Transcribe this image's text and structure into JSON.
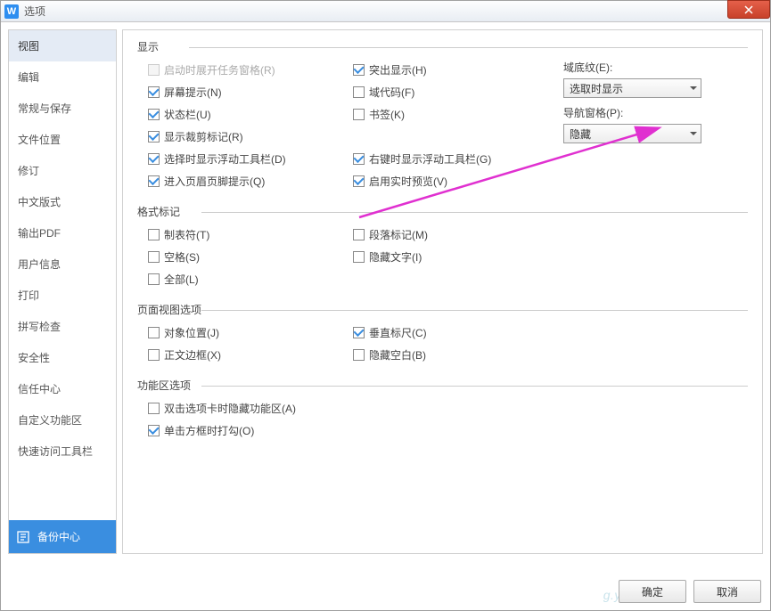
{
  "window": {
    "title": "选项",
    "logo_text": "W"
  },
  "sidebar": {
    "items": [
      "视图",
      "编辑",
      "常规与保存",
      "文件位置",
      "修订",
      "中文版式",
      "输出PDF",
      "用户信息",
      "打印",
      "拼写检查",
      "安全性",
      "信任中心",
      "自定义功能区",
      "快速访问工具栏"
    ],
    "active_index": 0,
    "backup_center": "备份中心"
  },
  "sections": {
    "display": {
      "title": "显示",
      "opts": {
        "startup_taskpane": "启动时展开任务窗格(R)",
        "screen_tip": "屏幕提示(N)",
        "status_bar": "状态栏(U)",
        "crop_marks": "显示裁剪标记(R)",
        "float_toolbar_select": "选择时显示浮动工具栏(D)",
        "header_footer_hint": "进入页眉页脚提示(Q)",
        "highlight": "突出显示(H)",
        "field_codes": "域代码(F)",
        "bookmarks": "书签(K)",
        "float_toolbar_rclick": "右键时显示浮动工具栏(G)",
        "live_preview": "启用实时预览(V)"
      },
      "field_shading_label": "域底纹(E):",
      "field_shading_value": "选取时显示",
      "nav_pane_label": "导航窗格(P):",
      "nav_pane_value": "隐藏"
    },
    "format_marks": {
      "title": "格式标记",
      "opts": {
        "tabs": "制表符(T)",
        "spaces": "空格(S)",
        "all": "全部(L)",
        "para_marks": "段落标记(M)",
        "hidden_text": "隐藏文字(I)"
      }
    },
    "page_view": {
      "title": "页面视图选项",
      "opts": {
        "object_pos": "对象位置(J)",
        "text_bounds": "正文边框(X)",
        "vertical_ruler": "垂直标尺(C)",
        "hide_blank": "隐藏空白(B)"
      }
    },
    "ribbon": {
      "title": "功能区选项",
      "opts": {
        "dblclick_hide": "双击选项卡时隐藏功能区(A)",
        "click_check": "单击方框时打勾(O)"
      }
    }
  },
  "footer": {
    "ok": "确定",
    "cancel": "取消"
  }
}
